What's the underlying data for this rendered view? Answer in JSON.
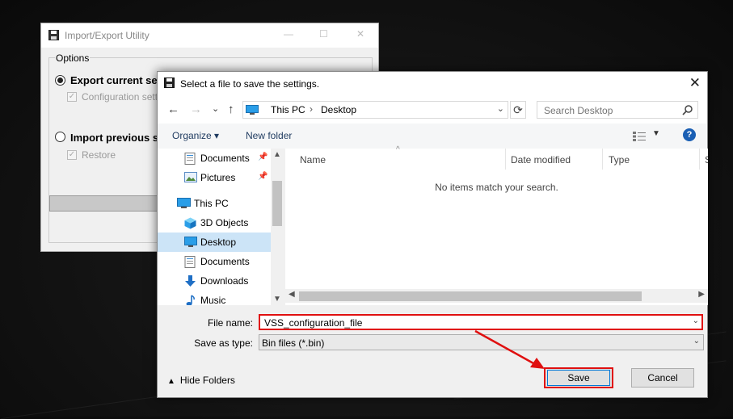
{
  "background_window": {
    "title": "Import/Export Utility",
    "controls": {
      "minimize": "—",
      "maximize": "☐",
      "close": "✕"
    },
    "options_label": "Options",
    "export_label": "Export current se",
    "configuration_label": "Configuration setting",
    "import_label": "Import previous s",
    "restore_label": "Restore"
  },
  "dialog": {
    "title": "Select a file to save the settings.",
    "close_glyph": "✕",
    "nav": {
      "back": "←",
      "forward": "→",
      "recent": "⌄",
      "up": "↑",
      "refresh": "⟳",
      "breadcrumb": [
        "This PC",
        "Desktop"
      ],
      "search_placeholder": "Search Desktop"
    },
    "toolbar": {
      "organize": "Organize ▾",
      "new_folder": "New folder",
      "help": "?"
    },
    "nav_pane": [
      {
        "label": "Documents",
        "icon": "documents-icon",
        "pinned": true
      },
      {
        "label": "Pictures",
        "icon": "pictures-icon",
        "pinned": true
      },
      {
        "label": "This PC",
        "icon": "this-pc-icon",
        "pinned": false
      },
      {
        "label": "3D Objects",
        "icon": "3d-objects-icon",
        "pinned": false
      },
      {
        "label": "Desktop",
        "icon": "desktop-icon",
        "pinned": false,
        "selected": true
      },
      {
        "label": "Documents",
        "icon": "documents-icon",
        "pinned": false
      },
      {
        "label": "Downloads",
        "icon": "downloads-icon",
        "pinned": false
      },
      {
        "label": "Music",
        "icon": "music-icon",
        "pinned": false
      }
    ],
    "columns": [
      "Name",
      "Date modified",
      "Type",
      "S"
    ],
    "empty_message": "No items match your search.",
    "file_name_label": "File name:",
    "file_name_value": "VSS_configuration_file",
    "save_as_type_label": "Save as type:",
    "save_as_type_value": "Bin files (*.bin)",
    "hide_folders": "Hide Folders",
    "save_button": "Save",
    "cancel_button": "Cancel"
  },
  "colors": {
    "highlight_red": "#e01010",
    "selection_blue": "#cce4f7",
    "accent_blue": "#0078d7"
  }
}
